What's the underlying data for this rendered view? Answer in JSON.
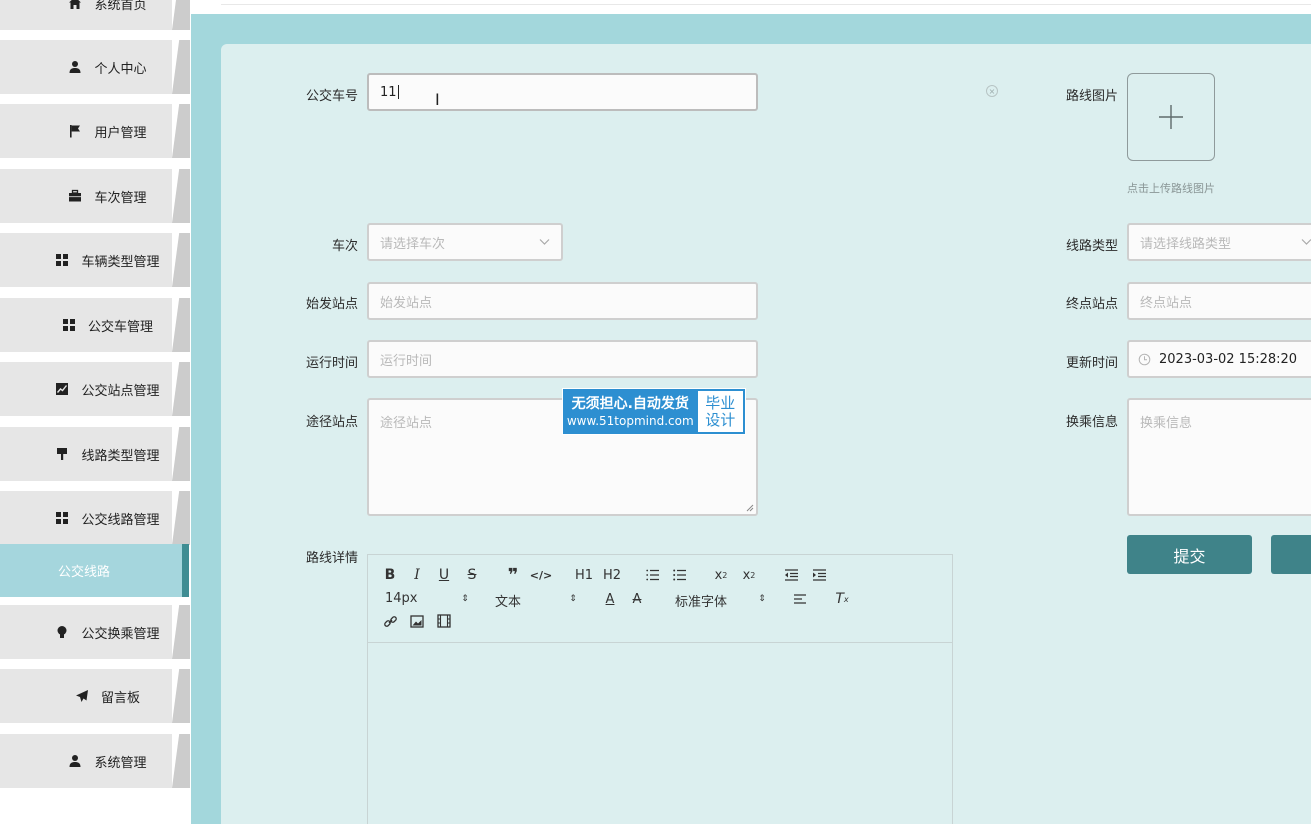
{
  "sidebar": {
    "items": [
      {
        "label": "系统首页",
        "icon": "home-icon"
      },
      {
        "label": "个人中心",
        "icon": "user-icon"
      },
      {
        "label": "用户管理",
        "icon": "flag-icon"
      },
      {
        "label": "车次管理",
        "icon": "briefcase-icon"
      },
      {
        "label": "车辆类型管理",
        "icon": "grid-icon"
      },
      {
        "label": "公交车管理",
        "icon": "grid-icon"
      },
      {
        "label": "公交站点管理",
        "icon": "chart-icon"
      },
      {
        "label": "线路类型管理",
        "icon": "paint-roller-icon"
      },
      {
        "label": "公交线路管理",
        "icon": "grid-icon"
      },
      {
        "label": "公交线路",
        "icon": "",
        "active": true
      },
      {
        "label": "公交换乘管理",
        "icon": "lightbulb-icon"
      },
      {
        "label": "留言板",
        "icon": "paper-plane-icon"
      },
      {
        "label": "系统管理",
        "icon": "user-icon"
      }
    ]
  },
  "form": {
    "bus_no": {
      "label": "公交车号",
      "value": "11"
    },
    "route_image": {
      "label": "路线图片",
      "hint": "点击上传路线图片",
      "plus": "+"
    },
    "trip": {
      "label": "车次",
      "placeholder": "请选择车次"
    },
    "route_type": {
      "label": "线路类型",
      "placeholder": "请选择线路类型"
    },
    "start_station": {
      "label": "始发站点",
      "placeholder": "始发站点"
    },
    "end_station": {
      "label": "终点站点",
      "placeholder": "终点站点"
    },
    "run_time": {
      "label": "运行时间",
      "placeholder": "运行时间"
    },
    "update_time": {
      "label": "更新时间",
      "value": "2023-03-02 15:28:20"
    },
    "via_stations": {
      "label": "途径站点",
      "placeholder": "途径站点"
    },
    "transfer_info": {
      "label": "换乘信息",
      "placeholder": "换乘信息"
    },
    "route_detail": {
      "label": "路线详情"
    },
    "submit_label": "提交"
  },
  "editor": {
    "font_size": "14px",
    "block_type": "文本",
    "font_family": "标准字体",
    "h1": "H1",
    "h2": "H2"
  },
  "watermark": {
    "line1": "无须担心.自动发货",
    "line2": "www.51topmind.com",
    "side1": "毕业",
    "side2": "设计"
  },
  "colors": {
    "sidebar_bg": "#e6e6e6",
    "active_bg": "#a5d6dd",
    "main_bg": "#a3d7dc",
    "card_bg": "#dcefef",
    "button": "#3f8389"
  }
}
